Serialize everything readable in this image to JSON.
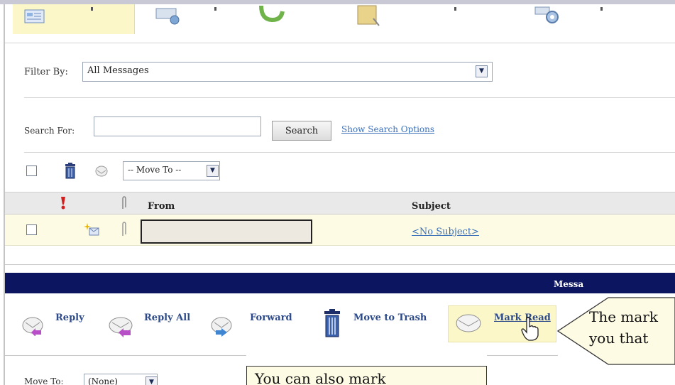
{
  "filter": {
    "label": "Filter By:",
    "value": "All Messages"
  },
  "search": {
    "label": "Search For:",
    "value": "",
    "button": "Search",
    "options_link": "Show Search Options"
  },
  "bulk": {
    "move_to": "-- Move To --"
  },
  "table": {
    "headers": {
      "from": "From",
      "subject": "Subject"
    },
    "rows": [
      {
        "from": "",
        "subject": "<No Subject>"
      }
    ]
  },
  "message_bar": {
    "title": "Messa"
  },
  "actions": {
    "reply": "Reply",
    "reply_all": "Reply All",
    "forward": "Forward",
    "move_to_trash": "Move to Trash",
    "mark_read": "Mark Read"
  },
  "move_to_lower": {
    "label": "Move To:",
    "value": "(None)"
  },
  "callouts": {
    "right_line1": "The mark",
    "right_line2": "you that",
    "bottom_line1": "You can also mark"
  },
  "colors": {
    "nav": "#0c1660",
    "highlight": "#fbf7c8",
    "link": "#3a6fb8"
  }
}
